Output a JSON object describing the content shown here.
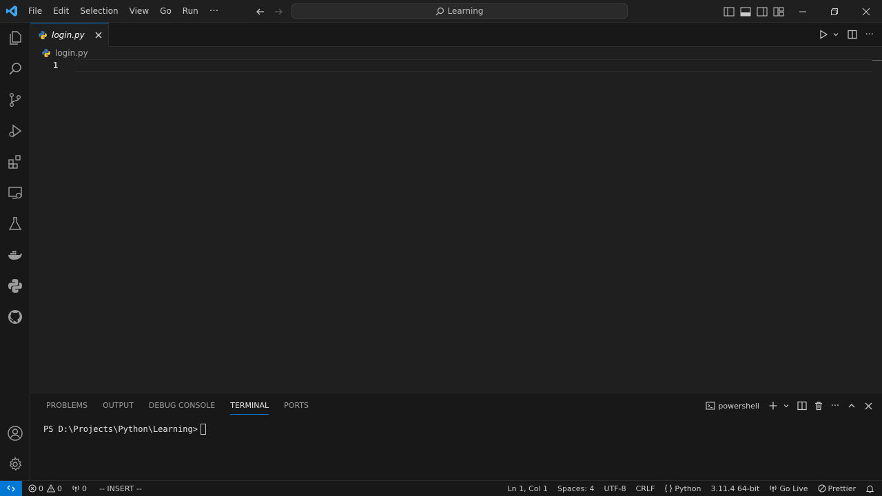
{
  "menu": [
    "File",
    "Edit",
    "Selection",
    "View",
    "Go",
    "Run"
  ],
  "menu_more": "···",
  "search": {
    "text": "Learning"
  },
  "tab": {
    "label": "login.py",
    "close": "✕"
  },
  "breadcrumb": {
    "file": "login.py"
  },
  "editor": {
    "line_number": "1"
  },
  "panel": {
    "tabs": [
      "PROBLEMS",
      "OUTPUT",
      "DEBUG CONSOLE",
      "TERMINAL",
      "PORTS"
    ],
    "active_tab": "TERMINAL",
    "shell": "powershell",
    "more": "···"
  },
  "terminal": {
    "prompt": "PS D:\\Projects\\Python\\Learning>"
  },
  "statusbar": {
    "errors": "0",
    "warnings": "0",
    "ports": "0",
    "mode": "-- INSERT --",
    "position": "Ln 1, Col 1",
    "spaces": "Spaces: 4",
    "encoding": "UTF-8",
    "eol": "CRLF",
    "language": "Python",
    "interpreter": "3.11.4 64-bit",
    "golive": "Go Live",
    "prettier": "Prettier"
  },
  "colors": {
    "accent": "#0078d4",
    "background": "#1f1f1f",
    "sidebar": "#181818"
  }
}
